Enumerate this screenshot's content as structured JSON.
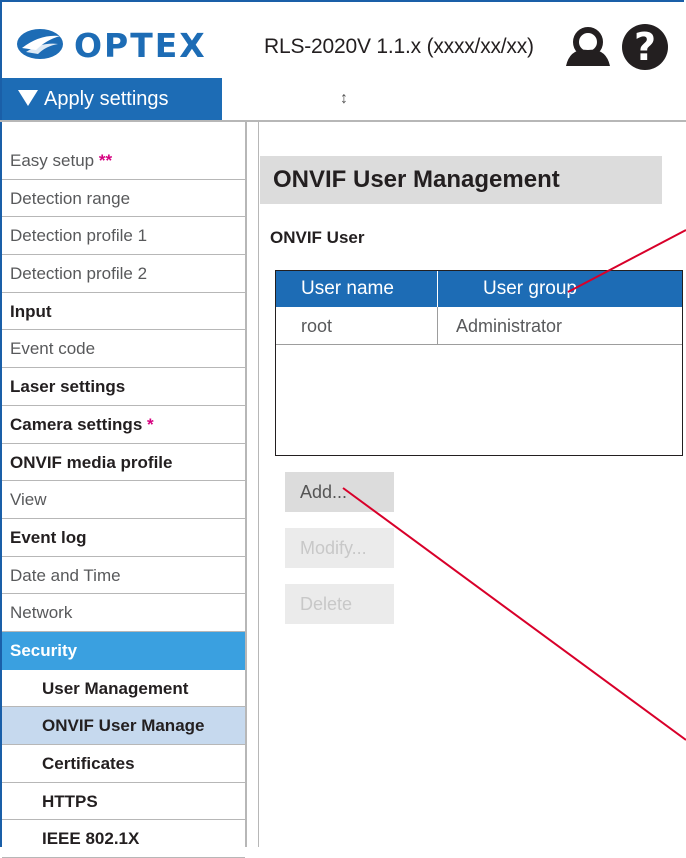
{
  "header": {
    "brand": "OPTEX",
    "title": "RLS-2020V 1.1.x (xxxx/xx/xx)",
    "user_icon": "user-icon",
    "help_icon": "question-icon"
  },
  "apply_label": "Apply settings",
  "resize_glyph": "↕",
  "sidebar": {
    "items": [
      {
        "label": "Easy setup",
        "mark": "**"
      },
      {
        "label": "Detection range"
      },
      {
        "label": "Detection profile 1"
      },
      {
        "label": "Detection profile 2"
      },
      {
        "label": "Input"
      },
      {
        "label": "Event code"
      },
      {
        "label": "Laser settings"
      },
      {
        "label": "Camera settings",
        "mark": "*"
      },
      {
        "label": "ONVIF media profile"
      },
      {
        "label": "View"
      },
      {
        "label": "Event log"
      },
      {
        "label": "Date and Time"
      },
      {
        "label": "Network"
      },
      {
        "label": "Security"
      },
      {
        "label": "User Management"
      },
      {
        "label": "ONVIF User Manage"
      },
      {
        "label": "Certificates"
      },
      {
        "label": "HTTPS"
      },
      {
        "label": "IEEE 802.1X"
      }
    ]
  },
  "main": {
    "page_title": "ONVIF User Management",
    "section_title": "ONVIF User",
    "table": {
      "columns": [
        "User name",
        "User group"
      ],
      "rows": [
        [
          "root",
          "Administrator"
        ]
      ]
    },
    "buttons": {
      "add": "Add...",
      "modify": "Modify...",
      "delete": "Delete"
    }
  },
  "colors": {
    "brand_blue": "#1d6cb5",
    "security_blue": "#3aa0e0",
    "active_item": "#c6d9ee",
    "mark_magenta": "#d6007f",
    "annotation_red": "#d8002a"
  }
}
